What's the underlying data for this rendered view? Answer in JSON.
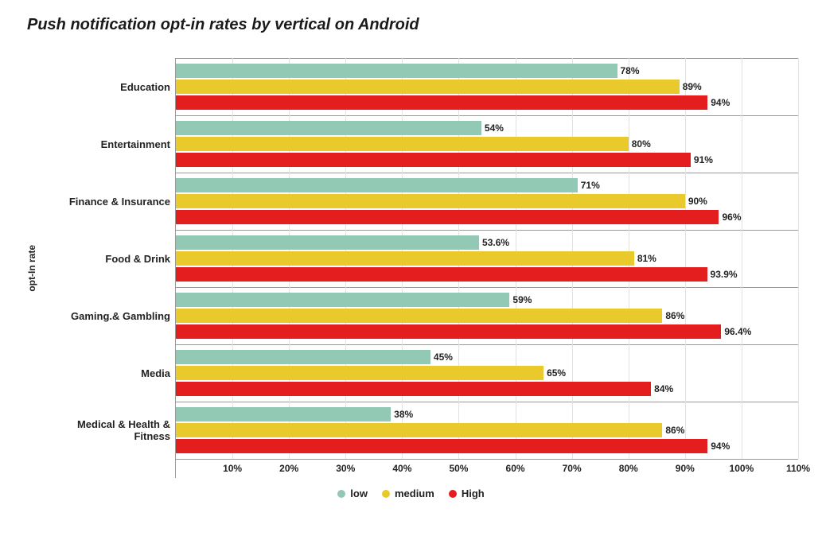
{
  "chart_data": {
    "type": "bar",
    "orientation": "horizontal",
    "title": "Push notification opt-in rates by vertical on Android",
    "xlabel": "",
    "ylabel": "opt-In rate",
    "xlim": [
      0,
      110
    ],
    "xticks": [
      10,
      20,
      30,
      40,
      50,
      60,
      70,
      80,
      90,
      100,
      110
    ],
    "xtick_labels": [
      "10%",
      "20%",
      "30%",
      "40%",
      "50%",
      "60%",
      "70%",
      "80%",
      "90%",
      "100%",
      "110%"
    ],
    "categories": [
      "Education",
      "Entertainment",
      "Finance & Insurance",
      "Food & Drink",
      "Gaming.& Gambling",
      "Media",
      "Medical & Health & Fitness"
    ],
    "series": [
      {
        "name": "low",
        "color": "#91c9b4",
        "values": [
          78,
          54,
          71,
          53.6,
          59,
          45,
          38
        ],
        "value_labels": [
          "78%",
          "54%",
          "71%",
          "53.6%",
          "59%",
          "45%",
          "38%"
        ]
      },
      {
        "name": "medium",
        "color": "#e9c92c",
        "values": [
          89,
          80,
          90,
          81,
          86,
          65,
          86
        ],
        "value_labels": [
          "89%",
          "80%",
          "90%",
          "81%",
          "86%",
          "65%",
          "86%"
        ]
      },
      {
        "name": "High",
        "color": "#e41e1e",
        "values": [
          94,
          91,
          96,
          93.9,
          96.4,
          84,
          94
        ],
        "value_labels": [
          "94%",
          "91%",
          "96%",
          "93.9%",
          "96.4%",
          "84%",
          "94%"
        ]
      }
    ],
    "legend": {
      "position": "bottom",
      "items": [
        "low",
        "medium",
        "High"
      ]
    }
  }
}
